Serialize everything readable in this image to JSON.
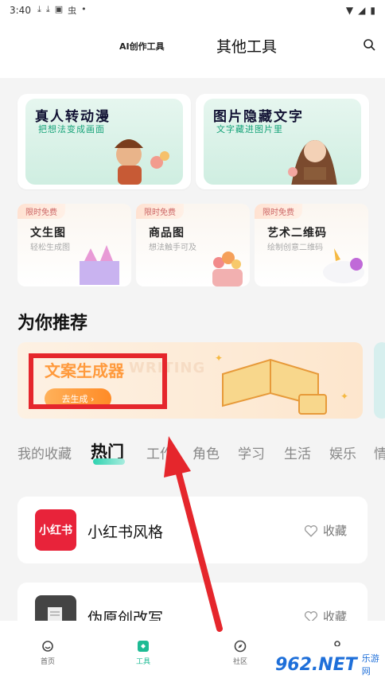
{
  "status": {
    "time": "3:40",
    "icons": [
      "download-icon",
      "download-icon",
      "a-icon",
      "bug-icon",
      "dot-icon"
    ],
    "right_icons": [
      "wifi-icon",
      "signal-icon",
      "battery-icon"
    ]
  },
  "header": {
    "tab_ai": "AI创作工具",
    "tab_other": "其他工具"
  },
  "feature_cards": [
    {
      "title": "真人转动漫",
      "subtitle": "把想法变成画面"
    },
    {
      "title": "图片隐藏文字",
      "subtitle": "文字藏进图片里"
    }
  ],
  "small_cards": [
    {
      "badge": "限时免费",
      "title": "文生图",
      "subtitle": "轻松生成图"
    },
    {
      "badge": "限时免费",
      "title": "商品图",
      "subtitle": "想法触手可及"
    },
    {
      "badge": "限时免费",
      "title": "艺术二维码",
      "subtitle": "绘制创意二维码"
    }
  ],
  "recommend": {
    "section_title": "为你推荐",
    "banner_title": "文案生成器",
    "banner_watermark": "WRITING",
    "banner_button": "去生成 ›"
  },
  "categories": [
    "我的收藏",
    "热门",
    "工作",
    "角色",
    "学习",
    "生活",
    "娱乐",
    "情"
  ],
  "active_category": "热门",
  "tools": [
    {
      "thumb_text": "小红书",
      "title": "小红书风格",
      "fav_label": "收藏"
    },
    {
      "thumb_text": "",
      "title": "伪原创改写",
      "fav_label": "收藏"
    }
  ],
  "bottom_nav": [
    {
      "label": "首页",
      "icon": "home-icon"
    },
    {
      "label": "工具",
      "icon": "tool-icon"
    },
    {
      "label": "社区",
      "icon": "compass-icon"
    },
    {
      "label": "",
      "icon": "profile-icon"
    }
  ],
  "watermark": {
    "main": "962.NET",
    "sub": "乐游网"
  },
  "colors": {
    "accent": "#1dbb94",
    "annotation_red": "#e5262c",
    "xhs_red": "#e8233a",
    "banner_orange": "#ff9a3c"
  }
}
